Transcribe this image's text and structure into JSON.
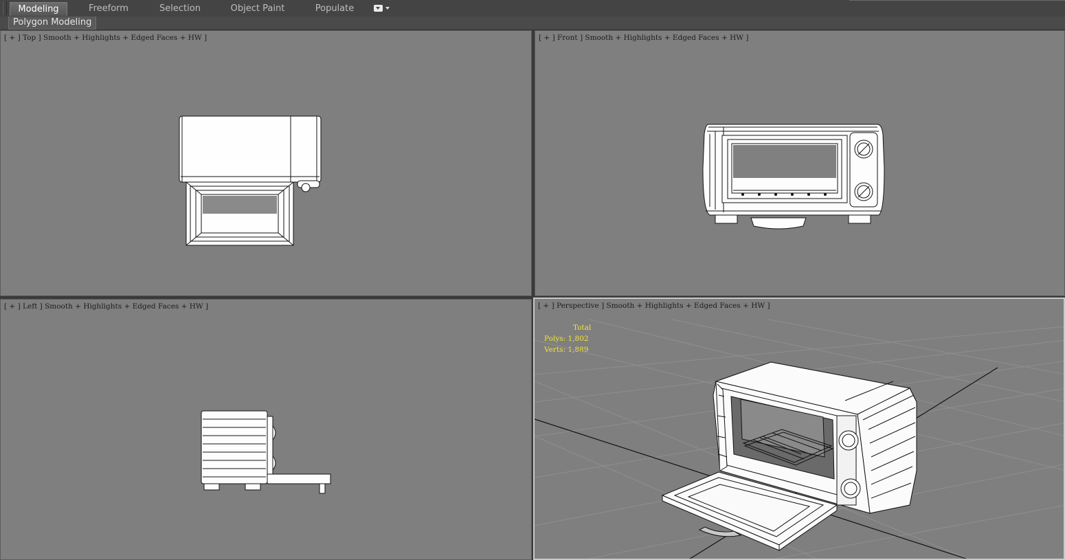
{
  "ribbon": {
    "tabs": [
      {
        "label": "Modeling",
        "active": true
      },
      {
        "label": "Freeform",
        "active": false
      },
      {
        "label": "Selection",
        "active": false
      },
      {
        "label": "Object Paint",
        "active": false
      },
      {
        "label": "Populate",
        "active": false
      }
    ],
    "panel_label": "Polygon Modeling"
  },
  "viewports": {
    "top": {
      "label": "[ + ] Top ] Smooth + Highlights + Edged Faces + HW ]"
    },
    "front": {
      "label": "[ + ] Front ] Smooth + Highlights + Edged Faces + HW ]"
    },
    "left": {
      "label": "[ + ] Left ] Smooth + Highlights + Edged Faces + HW ]"
    },
    "perspective": {
      "label": "[ + ] Perspective ] Smooth + Highlights + Edged Faces + HW ]"
    }
  },
  "stats": {
    "title": "Total",
    "polys_label": "Polys:",
    "polys_value": "1,802",
    "verts_label": "Verts:",
    "verts_value": "1,889"
  },
  "colors": {
    "viewport_bg": "#7f7f7f",
    "stats_text": "#f2e43a",
    "active_border": "#c9c9c9"
  }
}
